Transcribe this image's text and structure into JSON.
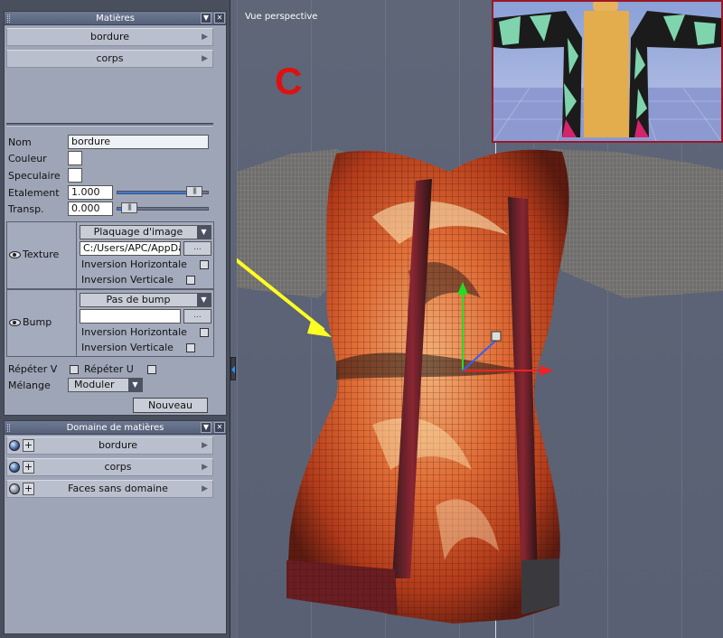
{
  "materials_panel": {
    "title": "Matières",
    "materials": [
      {
        "name": "bordure"
      },
      {
        "name": "corps"
      }
    ],
    "fields": {
      "name_label": "Nom",
      "name_value": "bordure",
      "color_label": "Couleur",
      "specular_label": "Speculaire",
      "spread_label": "Etalement",
      "spread_value": "1.000",
      "transparency_label": "Transp.",
      "transparency_value": "0.000"
    },
    "texture": {
      "label": "Texture",
      "mapping_selected": "Plaquage d'image",
      "path_value": "C:/Users/APC/AppData",
      "browse_label": "...",
      "flip_horizontal_label": "Inversion Horizontale",
      "flip_vertical_label": "Inversion Verticale"
    },
    "bump": {
      "label": "Bump",
      "mode_selected": "Pas de bump",
      "path_value": "",
      "browse_label": "...",
      "flip_horizontal_label": "Inversion Horizontale",
      "flip_vertical_label": "Inversion Verticale"
    },
    "repeat_v_label": "Répéter V",
    "repeat_u_label": "Répéter U",
    "blend_label": "Mélange",
    "blend_selected": "Moduler",
    "new_button_label": "Nouveau"
  },
  "domains_panel": {
    "title": "Domaine de matières",
    "items": [
      {
        "name": "bordure"
      },
      {
        "name": "corps"
      },
      {
        "name": "Faces sans domaine"
      }
    ]
  },
  "viewport": {
    "label": "Vue perspective",
    "annotation_letter": "C",
    "annotation_color": "#e01010",
    "arrow_color": "#ffff22"
  },
  "sliders": {
    "spread_fraction": 0.9,
    "transparency_fraction": 0.05
  }
}
